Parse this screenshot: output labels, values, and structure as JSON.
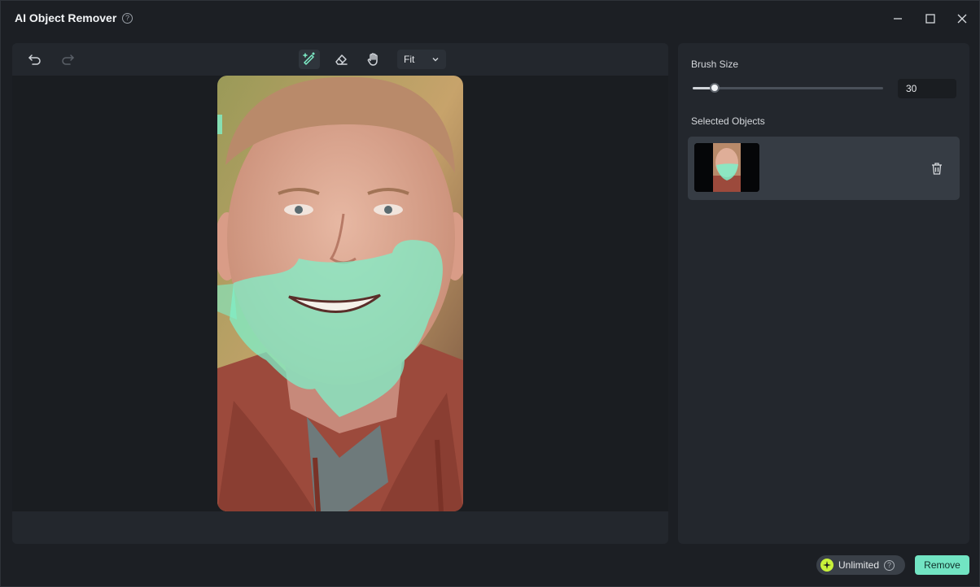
{
  "window": {
    "title": "AI Object Remover",
    "help_glyph": "?"
  },
  "toolbar": {
    "zoom_value": "Fit"
  },
  "side_panel": {
    "brush_size_label": "Brush Size",
    "brush_size_value": "30",
    "brush_size_fraction": 0.115,
    "selected_objects_label": "Selected Objects"
  },
  "footer": {
    "badge_label": "Unlimited",
    "badge_help_glyph": "?",
    "remove_label": "Remove"
  },
  "colors": {
    "accent": "#72e4c3",
    "badge_icon": "#c9f23a",
    "mask": "#7ff0c9"
  }
}
